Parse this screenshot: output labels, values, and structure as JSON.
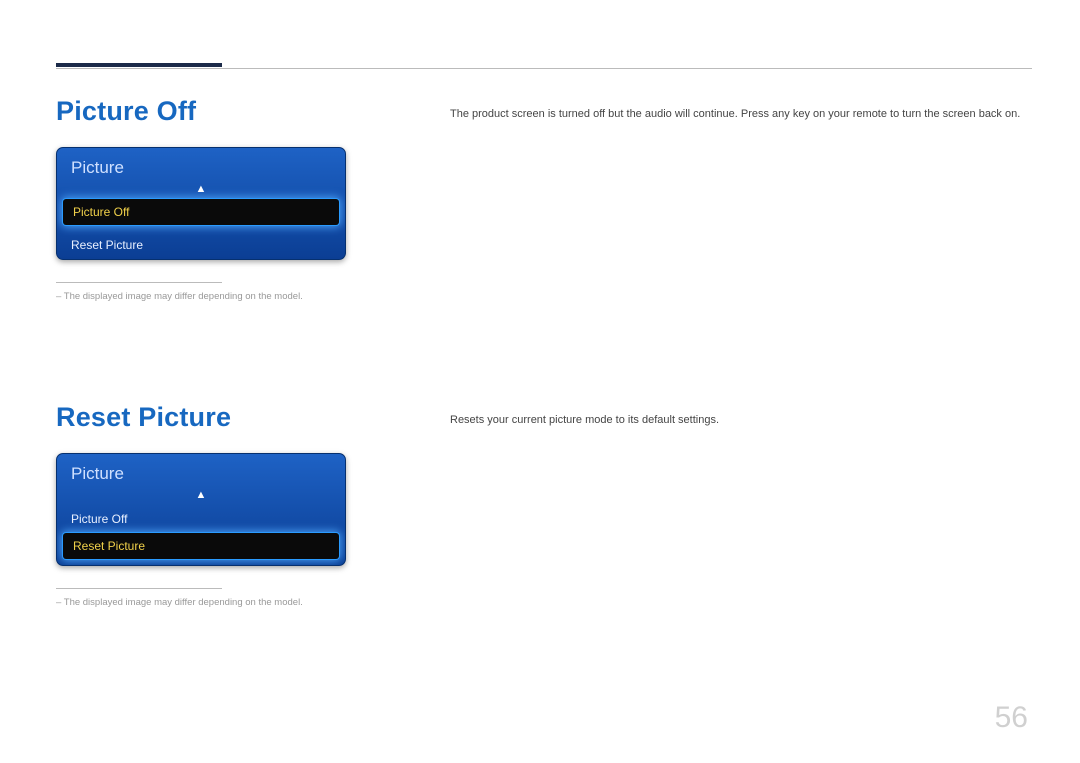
{
  "page_number": "56",
  "section1": {
    "heading": "Picture Off",
    "description": "The product screen is turned off but the audio will continue. Press any key on your remote to turn the screen back on.",
    "menu": {
      "title": "Picture",
      "items": [
        "Picture Off",
        "Reset Picture"
      ],
      "selected_index": 0
    },
    "note": "The displayed image may differ depending on the model."
  },
  "section2": {
    "heading": "Reset Picture",
    "description": "Resets your current picture mode to its default settings.",
    "menu": {
      "title": "Picture",
      "items": [
        "Picture Off",
        "Reset Picture"
      ],
      "selected_index": 1
    },
    "note": "The displayed image may differ depending on the model."
  }
}
